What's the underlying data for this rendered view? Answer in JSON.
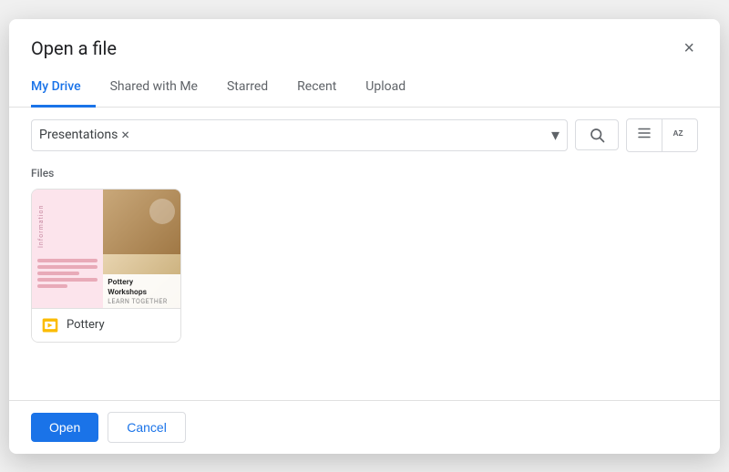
{
  "dialog": {
    "title": "Open a file",
    "close_label": "×"
  },
  "tabs": [
    {
      "id": "my-drive",
      "label": "My Drive",
      "active": true
    },
    {
      "id": "shared-with-me",
      "label": "Shared with Me",
      "active": false
    },
    {
      "id": "starred",
      "label": "Starred",
      "active": false
    },
    {
      "id": "recent",
      "label": "Recent",
      "active": false
    },
    {
      "id": "upload",
      "label": "Upload",
      "active": false
    }
  ],
  "toolbar": {
    "filter_tag": "Presentations",
    "filter_tag_close": "×",
    "search_icon": "search",
    "list_icon": "≡",
    "sort_icon": "AZ"
  },
  "content": {
    "files_label": "Files",
    "files": [
      {
        "id": "pottery",
        "name": "Pottery",
        "type": "slides",
        "thumb_title": "Pottery Workshops",
        "thumb_sub": "LEARN TOGETHER",
        "thumb_label": "Information"
      }
    ]
  },
  "footer": {
    "open_label": "Open",
    "cancel_label": "Cancel"
  }
}
